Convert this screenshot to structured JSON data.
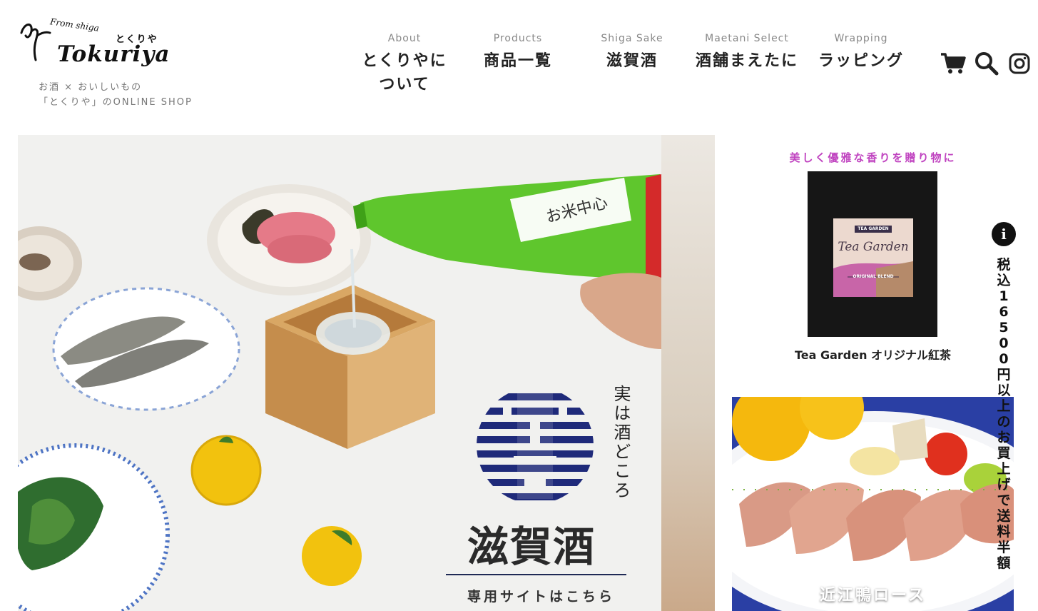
{
  "brand": {
    "from": "From shiga",
    "kana": "とくりや",
    "name": "Tokuriya",
    "tagline_1": "お酒 × おいしいもの",
    "tagline_2": "「とくりや」のONLINE SHOP"
  },
  "nav": [
    {
      "en": "About",
      "ja": "とくりやについて"
    },
    {
      "en": "Products",
      "ja": "商品一覧"
    },
    {
      "en": "Shiga Sake",
      "ja": "滋賀酒"
    },
    {
      "en": "Maetani Select",
      "ja": "酒舗まえたに"
    },
    {
      "en": "Wrapping",
      "ja": "ラッピング"
    }
  ],
  "header_icons": [
    "cart-icon",
    "search-icon",
    "instagram-icon"
  ],
  "hero": {
    "jitsu": "実は酒どころ",
    "title": "滋賀酒",
    "cta": "専用サイトはこちら",
    "bottle_label": "お米中心"
  },
  "promo1": {
    "catch": "美しく優雅な香りを贈り物に",
    "caption": "Tea Garden オリジナル紅茶",
    "pack_brand": "TEA GARDEN",
    "pack_title": "Tea Garden",
    "pack_sub": "ORIGINAL BLEND"
  },
  "promo2": {
    "caption": "近江鴨ロース"
  },
  "notice": {
    "icon": "i",
    "text": "税込16500円以上のお買上げで送料半額"
  },
  "colors": {
    "catch": "#c044c0",
    "hero_blue": "#1f2a55",
    "bottle_green": "#5fc62d",
    "promo2_bg": "#2a3fa4"
  }
}
